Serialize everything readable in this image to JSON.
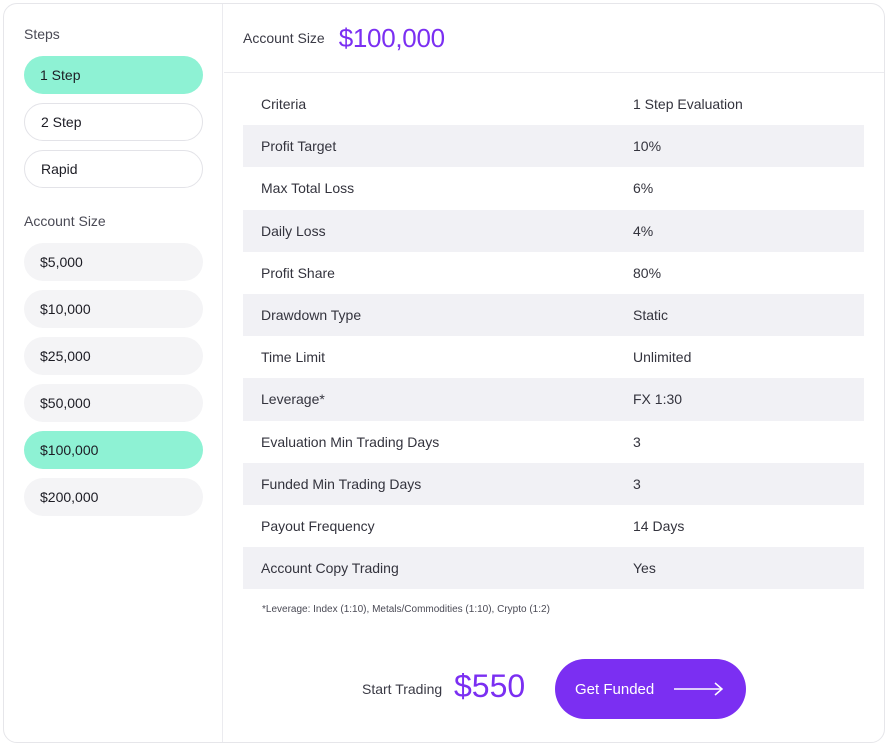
{
  "sidebar": {
    "steps_label": "Steps",
    "steps": [
      {
        "label": "1 Step",
        "active": true
      },
      {
        "label": "2 Step",
        "active": false
      },
      {
        "label": "Rapid",
        "active": false
      }
    ],
    "account_size_label": "Account Size",
    "sizes": [
      {
        "label": "$5,000",
        "active": false
      },
      {
        "label": "$10,000",
        "active": false
      },
      {
        "label": "$25,000",
        "active": false
      },
      {
        "label": "$50,000",
        "active": false
      },
      {
        "label": "$100,000",
        "active": true
      },
      {
        "label": "$200,000",
        "active": false
      }
    ]
  },
  "header": {
    "label": "Account Size",
    "value": "$100,000"
  },
  "table": {
    "rows": [
      {
        "criteria": "Criteria",
        "value": "1 Step Evaluation"
      },
      {
        "criteria": "Profit Target",
        "value": "10%"
      },
      {
        "criteria": "Max Total Loss",
        "value": "6%"
      },
      {
        "criteria": "Daily Loss",
        "value": "4%"
      },
      {
        "criteria": "Profit Share",
        "value": "80%"
      },
      {
        "criteria": "Drawdown Type",
        "value": "Static"
      },
      {
        "criteria": "Time Limit",
        "value": "Unlimited"
      },
      {
        "criteria": "Leverage*",
        "value": "FX 1:30"
      },
      {
        "criteria": "Evaluation Min Trading Days",
        "value": "3"
      },
      {
        "criteria": "Funded Min Trading Days",
        "value": "3"
      },
      {
        "criteria": "Payout Frequency",
        "value": "14 Days"
      },
      {
        "criteria": "Account Copy Trading",
        "value": "Yes"
      }
    ]
  },
  "footnote": "*Leverage: Index (1:10), Metals/Commodities (1:10), Crypto (1:2)",
  "footer": {
    "label": "Start Trading",
    "price": "$550",
    "cta_label": "Get Funded",
    "cta_icon": "arrow-right-icon"
  },
  "colors": {
    "accent": "#7b2ff2",
    "active_pill": "#8ef2d4",
    "row_shade": "#f1f1f5"
  }
}
